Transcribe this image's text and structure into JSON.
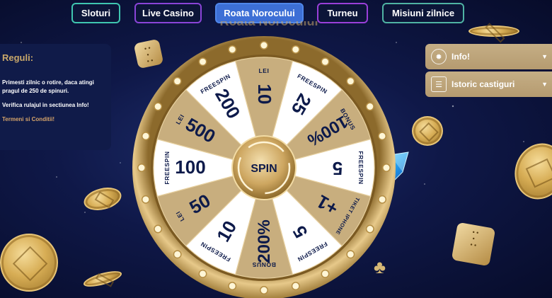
{
  "nav": {
    "items": [
      {
        "label": "Sloturi"
      },
      {
        "label": "Live Casino"
      },
      {
        "label": "Roata Norocului"
      },
      {
        "label": "Turneu"
      },
      {
        "label": "Misiuni zilnice"
      }
    ]
  },
  "page": {
    "title": "Roata Norocului"
  },
  "rules": {
    "heading": "Reguli:",
    "line1": "Primesti zilnic o rotire, daca atingi pragul de 250 de spinuri.",
    "line2": "Verifica rulajul in sectiunea Info!",
    "terms": "Termeni si Conditii!"
  },
  "side": {
    "info": {
      "label": "Info!",
      "icon": "roulette-icon"
    },
    "istoric": {
      "label": "Istoric castiguri",
      "icon": "list-icon"
    }
  },
  "wheel": {
    "spin_label": "SPIN",
    "colors": {
      "gold": "#c8ae7e",
      "white": "#ffffff",
      "text_dark": "#0d1a4a",
      "rim": "#d3b173"
    },
    "segments": [
      {
        "top": "LEI",
        "value": "10",
        "bg": "gold"
      },
      {
        "top": "FREESPIN",
        "value": "25",
        "bg": "white"
      },
      {
        "top": "BONUS",
        "value": "100%",
        "bg": "gold"
      },
      {
        "top": "FREESPIN",
        "value": "5",
        "bg": "white"
      },
      {
        "top": "TIKET IPHONE",
        "value": "+1",
        "bg": "gold"
      },
      {
        "top": "FREESPIN",
        "value": "5",
        "bg": "white"
      },
      {
        "top": "BONUS",
        "value": "200%",
        "bg": "gold"
      },
      {
        "top": "FREESPIN",
        "value": "10",
        "bg": "white"
      },
      {
        "top": "LEI",
        "value": "50",
        "bg": "gold"
      },
      {
        "top": "FREESPIN",
        "value": "100",
        "bg": "white"
      },
      {
        "top": "LEI",
        "value": "500",
        "bg": "gold"
      },
      {
        "top": "FREESPIN",
        "value": "200",
        "bg": "white"
      }
    ]
  }
}
